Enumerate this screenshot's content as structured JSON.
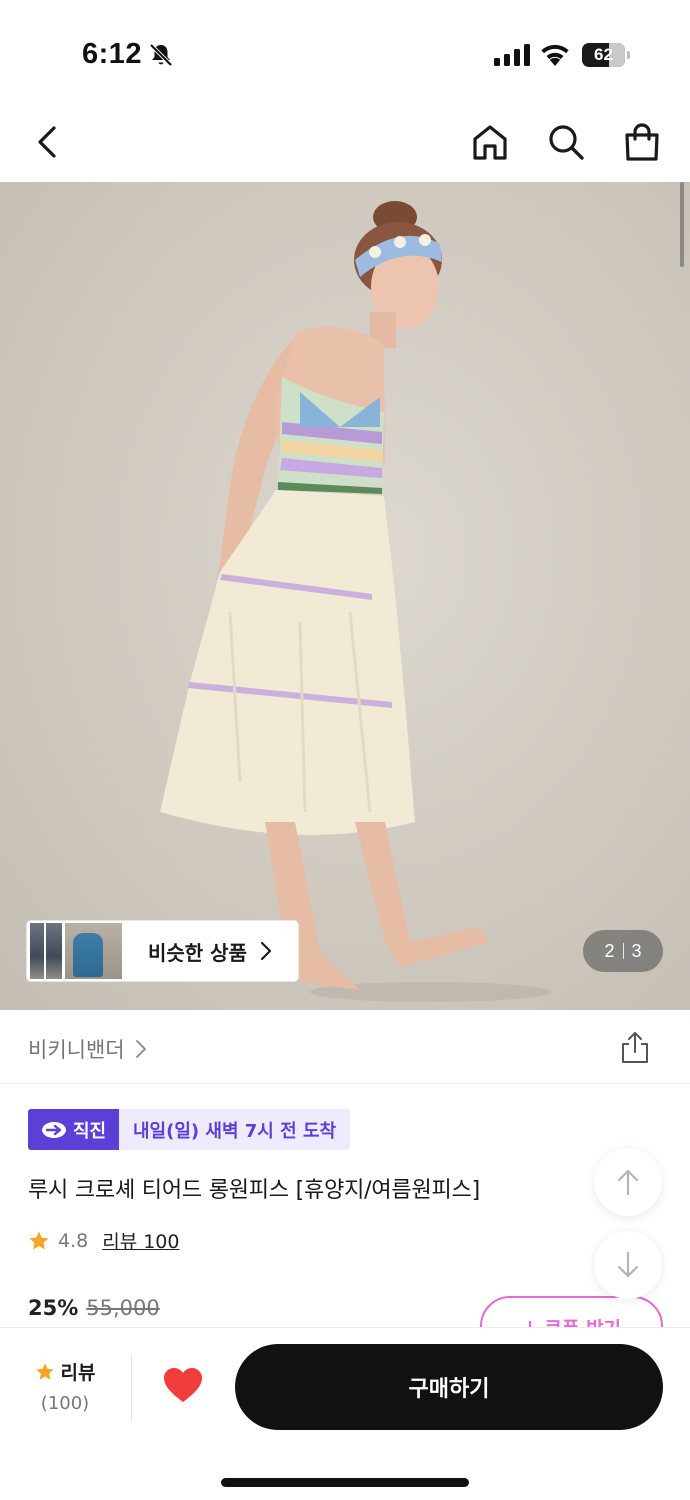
{
  "status_bar": {
    "time": "6:12",
    "battery_percent": "62",
    "battery_level": 0.62,
    "icons": [
      "bell-slash-icon",
      "signal-icon",
      "wifi-icon",
      "battery-icon"
    ]
  },
  "nav": {
    "icons": [
      "chevron-left-icon",
      "home-icon",
      "search-icon",
      "shopping-bag-icon"
    ]
  },
  "gallery": {
    "similar_label": "비슷한 상품",
    "current_page": "2",
    "total_pages": "3"
  },
  "product": {
    "brand": "비키니밴더",
    "delivery_badge": "직진",
    "delivery_text": "내일(일) 새벽 7시 전 도착",
    "title": "루시 크로셰 티어드 롱원피스 [휴양지/여름원피스]",
    "rating": "4.8",
    "review_label": "리뷰 100",
    "discount": "25%",
    "original_price": "55,000",
    "coupon_label": "↓ 쿠폰 받기"
  },
  "bottom_bar": {
    "review_label": "리뷰",
    "review_count": "(100)",
    "buy_label": "구매하기"
  },
  "colors": {
    "accent_purple": "#5b3fd6",
    "coupon_pink": "#e56bd2",
    "star": "#f5a623",
    "heart": "#f03c3c",
    "buy_button": "#111111"
  }
}
